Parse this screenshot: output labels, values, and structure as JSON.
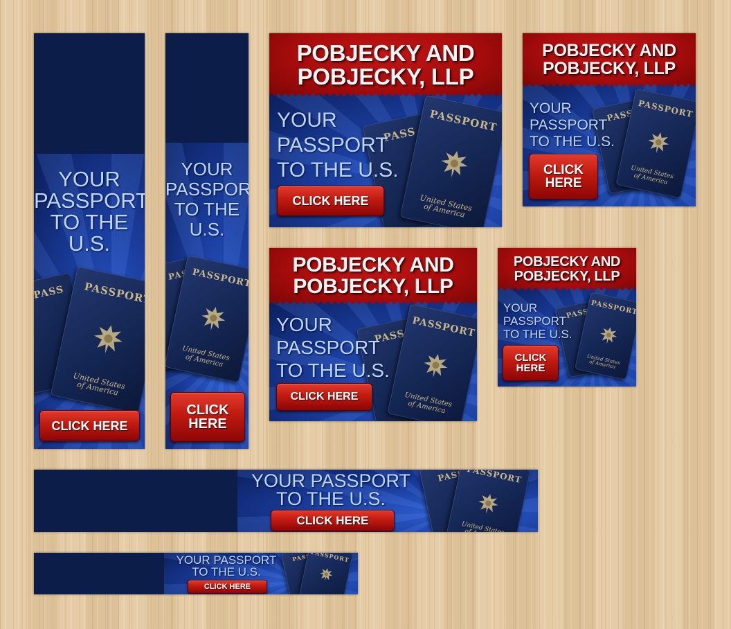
{
  "firm_name_lines": [
    "POBJECKY",
    "AND",
    "POBJECKY,",
    "LLP"
  ],
  "firm_name_two": [
    "POBJECKY AND",
    "POBJECKY, LLP"
  ],
  "tagline_lines": [
    "YOUR",
    "PASSPORT",
    "TO THE",
    "U.S."
  ],
  "tagline_three": [
    "YOUR",
    "PASSPORT",
    "TO THE U.S."
  ],
  "tagline_two": [
    "YOUR PASSPORT",
    "TO THE U.S."
  ],
  "button_label": "CLICK HERE",
  "button_two": [
    "CLICK",
    "HERE"
  ],
  "passport_title": "PASSPORT",
  "passport_title_partial": "PASS",
  "passport_subtitle": [
    "United States",
    "of America"
  ],
  "colors": {
    "brand_red": "#a80c0c",
    "banner_blue": "#1a3d9e",
    "button_red": "#c01a10",
    "tagline_blue": "#bcd7ff",
    "wood": "#e2c8a0"
  }
}
